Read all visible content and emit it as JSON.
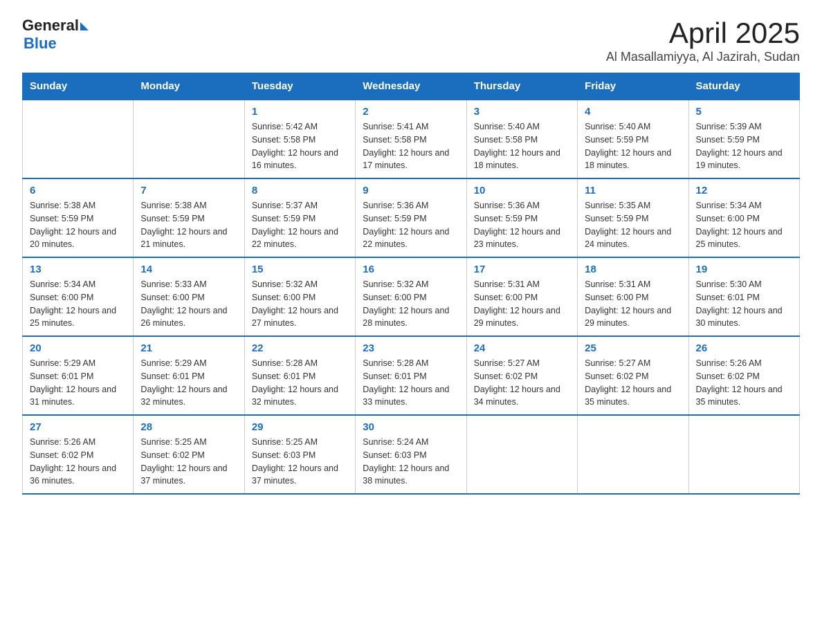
{
  "header": {
    "logo_general": "General",
    "logo_blue": "Blue",
    "title": "April 2025",
    "subtitle": "Al Masallamiyya, Al Jazirah, Sudan"
  },
  "calendar": {
    "days_of_week": [
      "Sunday",
      "Monday",
      "Tuesday",
      "Wednesday",
      "Thursday",
      "Friday",
      "Saturday"
    ],
    "weeks": [
      [
        {
          "day": "",
          "sunrise": "",
          "sunset": "",
          "daylight": ""
        },
        {
          "day": "",
          "sunrise": "",
          "sunset": "",
          "daylight": ""
        },
        {
          "day": "1",
          "sunrise": "Sunrise: 5:42 AM",
          "sunset": "Sunset: 5:58 PM",
          "daylight": "Daylight: 12 hours and 16 minutes."
        },
        {
          "day": "2",
          "sunrise": "Sunrise: 5:41 AM",
          "sunset": "Sunset: 5:58 PM",
          "daylight": "Daylight: 12 hours and 17 minutes."
        },
        {
          "day": "3",
          "sunrise": "Sunrise: 5:40 AM",
          "sunset": "Sunset: 5:58 PM",
          "daylight": "Daylight: 12 hours and 18 minutes."
        },
        {
          "day": "4",
          "sunrise": "Sunrise: 5:40 AM",
          "sunset": "Sunset: 5:59 PM",
          "daylight": "Daylight: 12 hours and 18 minutes."
        },
        {
          "day": "5",
          "sunrise": "Sunrise: 5:39 AM",
          "sunset": "Sunset: 5:59 PM",
          "daylight": "Daylight: 12 hours and 19 minutes."
        }
      ],
      [
        {
          "day": "6",
          "sunrise": "Sunrise: 5:38 AM",
          "sunset": "Sunset: 5:59 PM",
          "daylight": "Daylight: 12 hours and 20 minutes."
        },
        {
          "day": "7",
          "sunrise": "Sunrise: 5:38 AM",
          "sunset": "Sunset: 5:59 PM",
          "daylight": "Daylight: 12 hours and 21 minutes."
        },
        {
          "day": "8",
          "sunrise": "Sunrise: 5:37 AM",
          "sunset": "Sunset: 5:59 PM",
          "daylight": "Daylight: 12 hours and 22 minutes."
        },
        {
          "day": "9",
          "sunrise": "Sunrise: 5:36 AM",
          "sunset": "Sunset: 5:59 PM",
          "daylight": "Daylight: 12 hours and 22 minutes."
        },
        {
          "day": "10",
          "sunrise": "Sunrise: 5:36 AM",
          "sunset": "Sunset: 5:59 PM",
          "daylight": "Daylight: 12 hours and 23 minutes."
        },
        {
          "day": "11",
          "sunrise": "Sunrise: 5:35 AM",
          "sunset": "Sunset: 5:59 PM",
          "daylight": "Daylight: 12 hours and 24 minutes."
        },
        {
          "day": "12",
          "sunrise": "Sunrise: 5:34 AM",
          "sunset": "Sunset: 6:00 PM",
          "daylight": "Daylight: 12 hours and 25 minutes."
        }
      ],
      [
        {
          "day": "13",
          "sunrise": "Sunrise: 5:34 AM",
          "sunset": "Sunset: 6:00 PM",
          "daylight": "Daylight: 12 hours and 25 minutes."
        },
        {
          "day": "14",
          "sunrise": "Sunrise: 5:33 AM",
          "sunset": "Sunset: 6:00 PM",
          "daylight": "Daylight: 12 hours and 26 minutes."
        },
        {
          "day": "15",
          "sunrise": "Sunrise: 5:32 AM",
          "sunset": "Sunset: 6:00 PM",
          "daylight": "Daylight: 12 hours and 27 minutes."
        },
        {
          "day": "16",
          "sunrise": "Sunrise: 5:32 AM",
          "sunset": "Sunset: 6:00 PM",
          "daylight": "Daylight: 12 hours and 28 minutes."
        },
        {
          "day": "17",
          "sunrise": "Sunrise: 5:31 AM",
          "sunset": "Sunset: 6:00 PM",
          "daylight": "Daylight: 12 hours and 29 minutes."
        },
        {
          "day": "18",
          "sunrise": "Sunrise: 5:31 AM",
          "sunset": "Sunset: 6:00 PM",
          "daylight": "Daylight: 12 hours and 29 minutes."
        },
        {
          "day": "19",
          "sunrise": "Sunrise: 5:30 AM",
          "sunset": "Sunset: 6:01 PM",
          "daylight": "Daylight: 12 hours and 30 minutes."
        }
      ],
      [
        {
          "day": "20",
          "sunrise": "Sunrise: 5:29 AM",
          "sunset": "Sunset: 6:01 PM",
          "daylight": "Daylight: 12 hours and 31 minutes."
        },
        {
          "day": "21",
          "sunrise": "Sunrise: 5:29 AM",
          "sunset": "Sunset: 6:01 PM",
          "daylight": "Daylight: 12 hours and 32 minutes."
        },
        {
          "day": "22",
          "sunrise": "Sunrise: 5:28 AM",
          "sunset": "Sunset: 6:01 PM",
          "daylight": "Daylight: 12 hours and 32 minutes."
        },
        {
          "day": "23",
          "sunrise": "Sunrise: 5:28 AM",
          "sunset": "Sunset: 6:01 PM",
          "daylight": "Daylight: 12 hours and 33 minutes."
        },
        {
          "day": "24",
          "sunrise": "Sunrise: 5:27 AM",
          "sunset": "Sunset: 6:02 PM",
          "daylight": "Daylight: 12 hours and 34 minutes."
        },
        {
          "day": "25",
          "sunrise": "Sunrise: 5:27 AM",
          "sunset": "Sunset: 6:02 PM",
          "daylight": "Daylight: 12 hours and 35 minutes."
        },
        {
          "day": "26",
          "sunrise": "Sunrise: 5:26 AM",
          "sunset": "Sunset: 6:02 PM",
          "daylight": "Daylight: 12 hours and 35 minutes."
        }
      ],
      [
        {
          "day": "27",
          "sunrise": "Sunrise: 5:26 AM",
          "sunset": "Sunset: 6:02 PM",
          "daylight": "Daylight: 12 hours and 36 minutes."
        },
        {
          "day": "28",
          "sunrise": "Sunrise: 5:25 AM",
          "sunset": "Sunset: 6:02 PM",
          "daylight": "Daylight: 12 hours and 37 minutes."
        },
        {
          "day": "29",
          "sunrise": "Sunrise: 5:25 AM",
          "sunset": "Sunset: 6:03 PM",
          "daylight": "Daylight: 12 hours and 37 minutes."
        },
        {
          "day": "30",
          "sunrise": "Sunrise: 5:24 AM",
          "sunset": "Sunset: 6:03 PM",
          "daylight": "Daylight: 12 hours and 38 minutes."
        },
        {
          "day": "",
          "sunrise": "",
          "sunset": "",
          "daylight": ""
        },
        {
          "day": "",
          "sunrise": "",
          "sunset": "",
          "daylight": ""
        },
        {
          "day": "",
          "sunrise": "",
          "sunset": "",
          "daylight": ""
        }
      ]
    ]
  }
}
